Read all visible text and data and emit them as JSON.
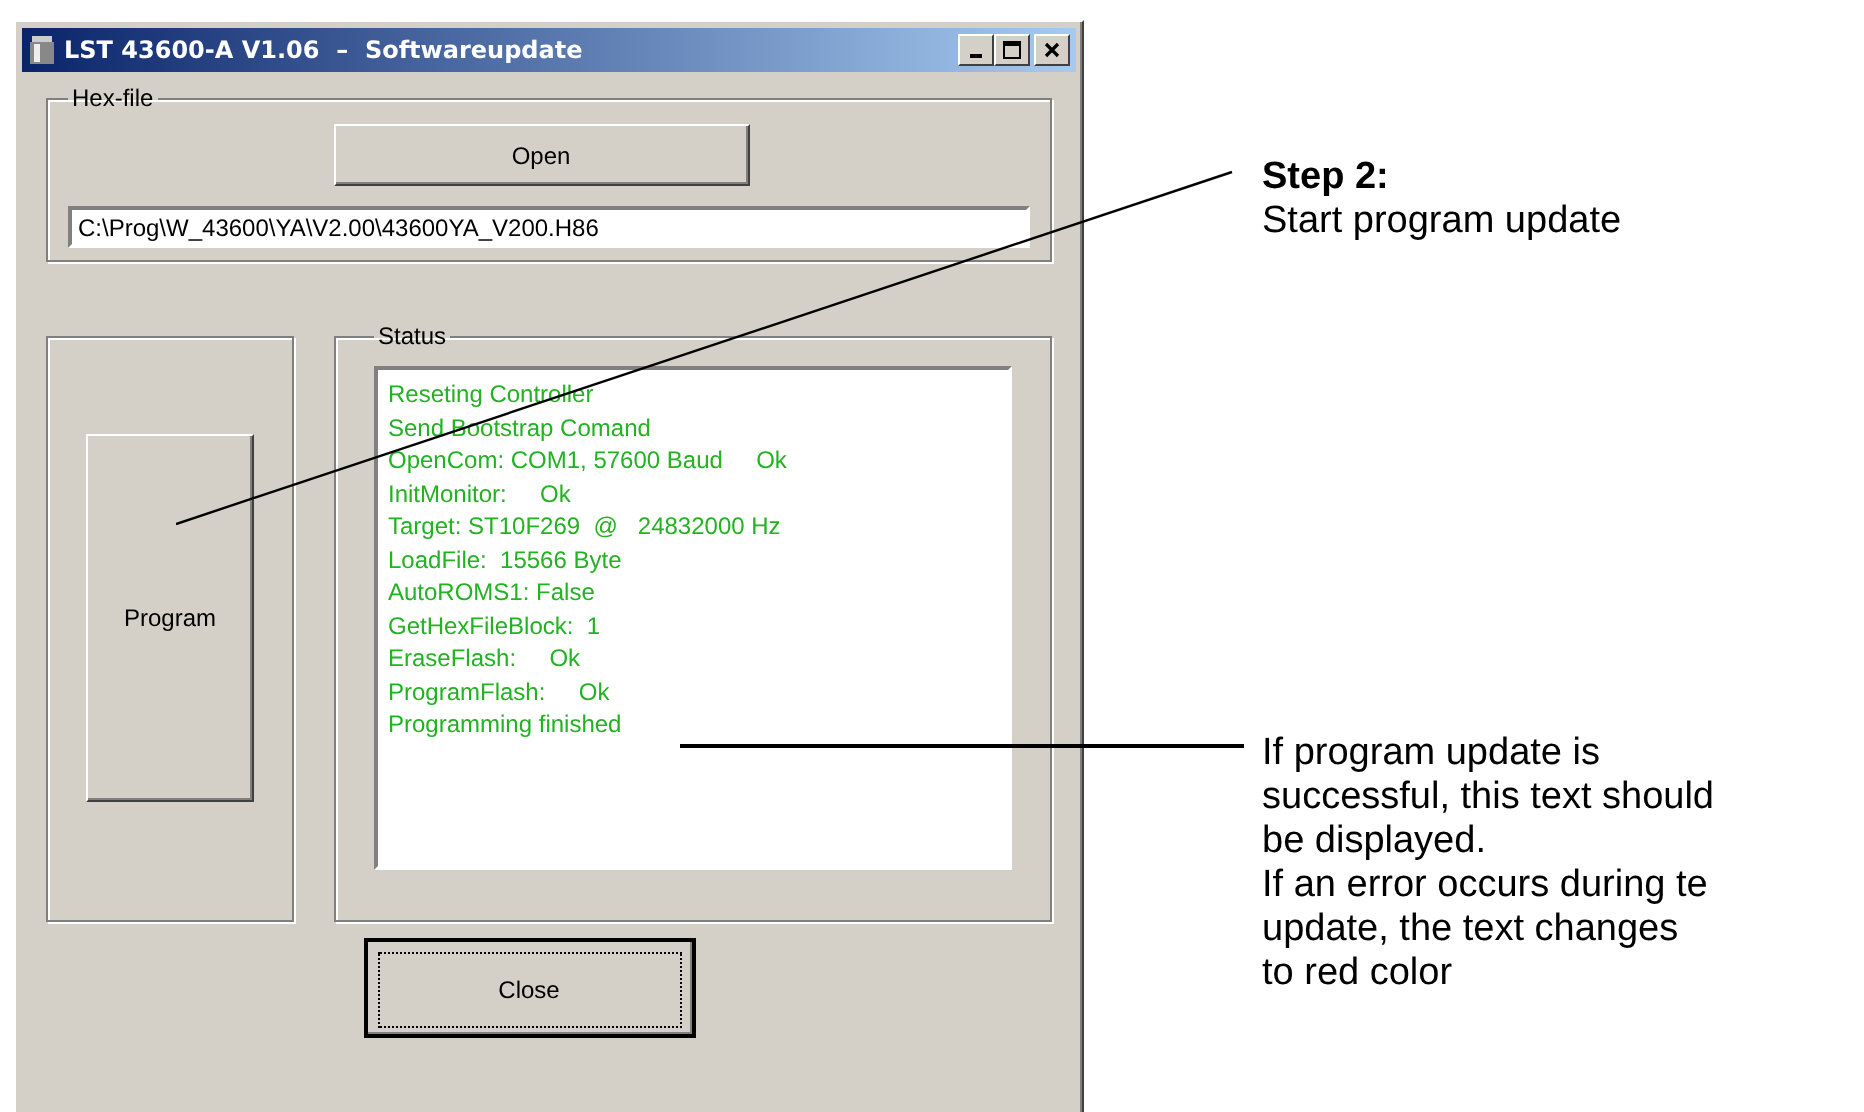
{
  "window": {
    "title": "LST 43600-A V1.06  –  Softwareupdate"
  },
  "hex_file": {
    "label": "Hex-file",
    "open_button": "Open",
    "path": "C:\\Prog\\W_43600\\YA\\V2.00\\43600YA_V200.H86"
  },
  "program_button": "Program",
  "status": {
    "label": "Status",
    "lines": [
      "Reseting Controller",
      "Send Bootstrap Comand",
      "OpenCom: COM1, 57600 Baud     Ok",
      "InitMonitor:     Ok",
      "Target: ST10F269  @   24832000 Hz",
      "LoadFile:  15566 Byte",
      "AutoROMS1: False",
      "GetHexFileBlock:  1",
      "EraseFlash:     Ok",
      "ProgramFlash:     Ok",
      "Programming finished"
    ]
  },
  "close_button": "Close",
  "annotations": [
    {
      "title": "Step 2:",
      "text": "Start program update"
    },
    {
      "text": "If program update is\nsuccessful, this text should\nbe displayed.\nIf an error occurs during te\nupdate, the text changes\nto red color"
    }
  ]
}
